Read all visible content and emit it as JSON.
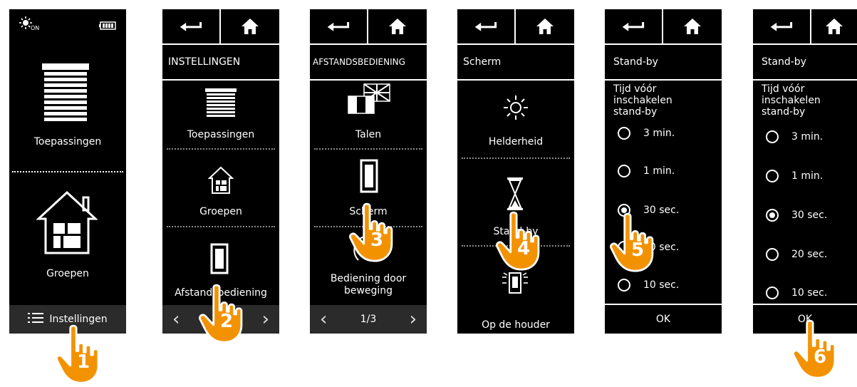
{
  "colors": {
    "accent": "#f39200",
    "screen_bg": "#000000",
    "text": "#ffffff"
  },
  "screen1": {
    "status_sun_label": "ON",
    "items": [
      {
        "label": "Toepassingen",
        "icon": "blinds-icon"
      },
      {
        "label": "Groepen",
        "icon": "house-icon"
      }
    ],
    "bottom_label": "Instellingen",
    "step": "1"
  },
  "screen2": {
    "title": "INSTELLINGEN",
    "items": [
      {
        "label": "Toepassingen",
        "icon": "blinds-icon"
      },
      {
        "label": "Groepen",
        "icon": "house-icon"
      },
      {
        "label": "Afstandsbediening",
        "icon": "remote-icon"
      }
    ],
    "step": "2"
  },
  "screen3": {
    "title": "AFSTANDSBEDIENING",
    "items": [
      {
        "label": "Talen",
        "icon": "flags-icon"
      },
      {
        "label": "Scherm",
        "icon": "remote-icon"
      },
      {
        "label": "Bediening door beweging",
        "icon": "motion-icon"
      }
    ],
    "page": "1/3",
    "step": "3"
  },
  "screen4": {
    "title": "Scherm",
    "items": [
      {
        "label": "Helderheid",
        "icon": "sun-icon"
      },
      {
        "label": "Stand-by",
        "icon": "hourglass-icon"
      },
      {
        "label": "Op de houder",
        "icon": "remote-holder-icon"
      }
    ],
    "step": "4"
  },
  "screen5": {
    "title": "Stand-by",
    "prompt": [
      "Tijd vóór",
      "inschakelen",
      "stand-by"
    ],
    "options": [
      "3 min.",
      "1 min.",
      "30 sec.",
      "20 sec.",
      "10 sec."
    ],
    "selected": 2,
    "ok": "OK",
    "step": "5"
  },
  "screen6": {
    "title": "Stand-by",
    "prompt": [
      "Tijd vóór",
      "inschakelen",
      "stand-by"
    ],
    "options": [
      "3 min.",
      "1 min.",
      "30 sec.",
      "20 sec.",
      "10 sec."
    ],
    "selected": 2,
    "ok": "OK",
    "step": "6"
  }
}
